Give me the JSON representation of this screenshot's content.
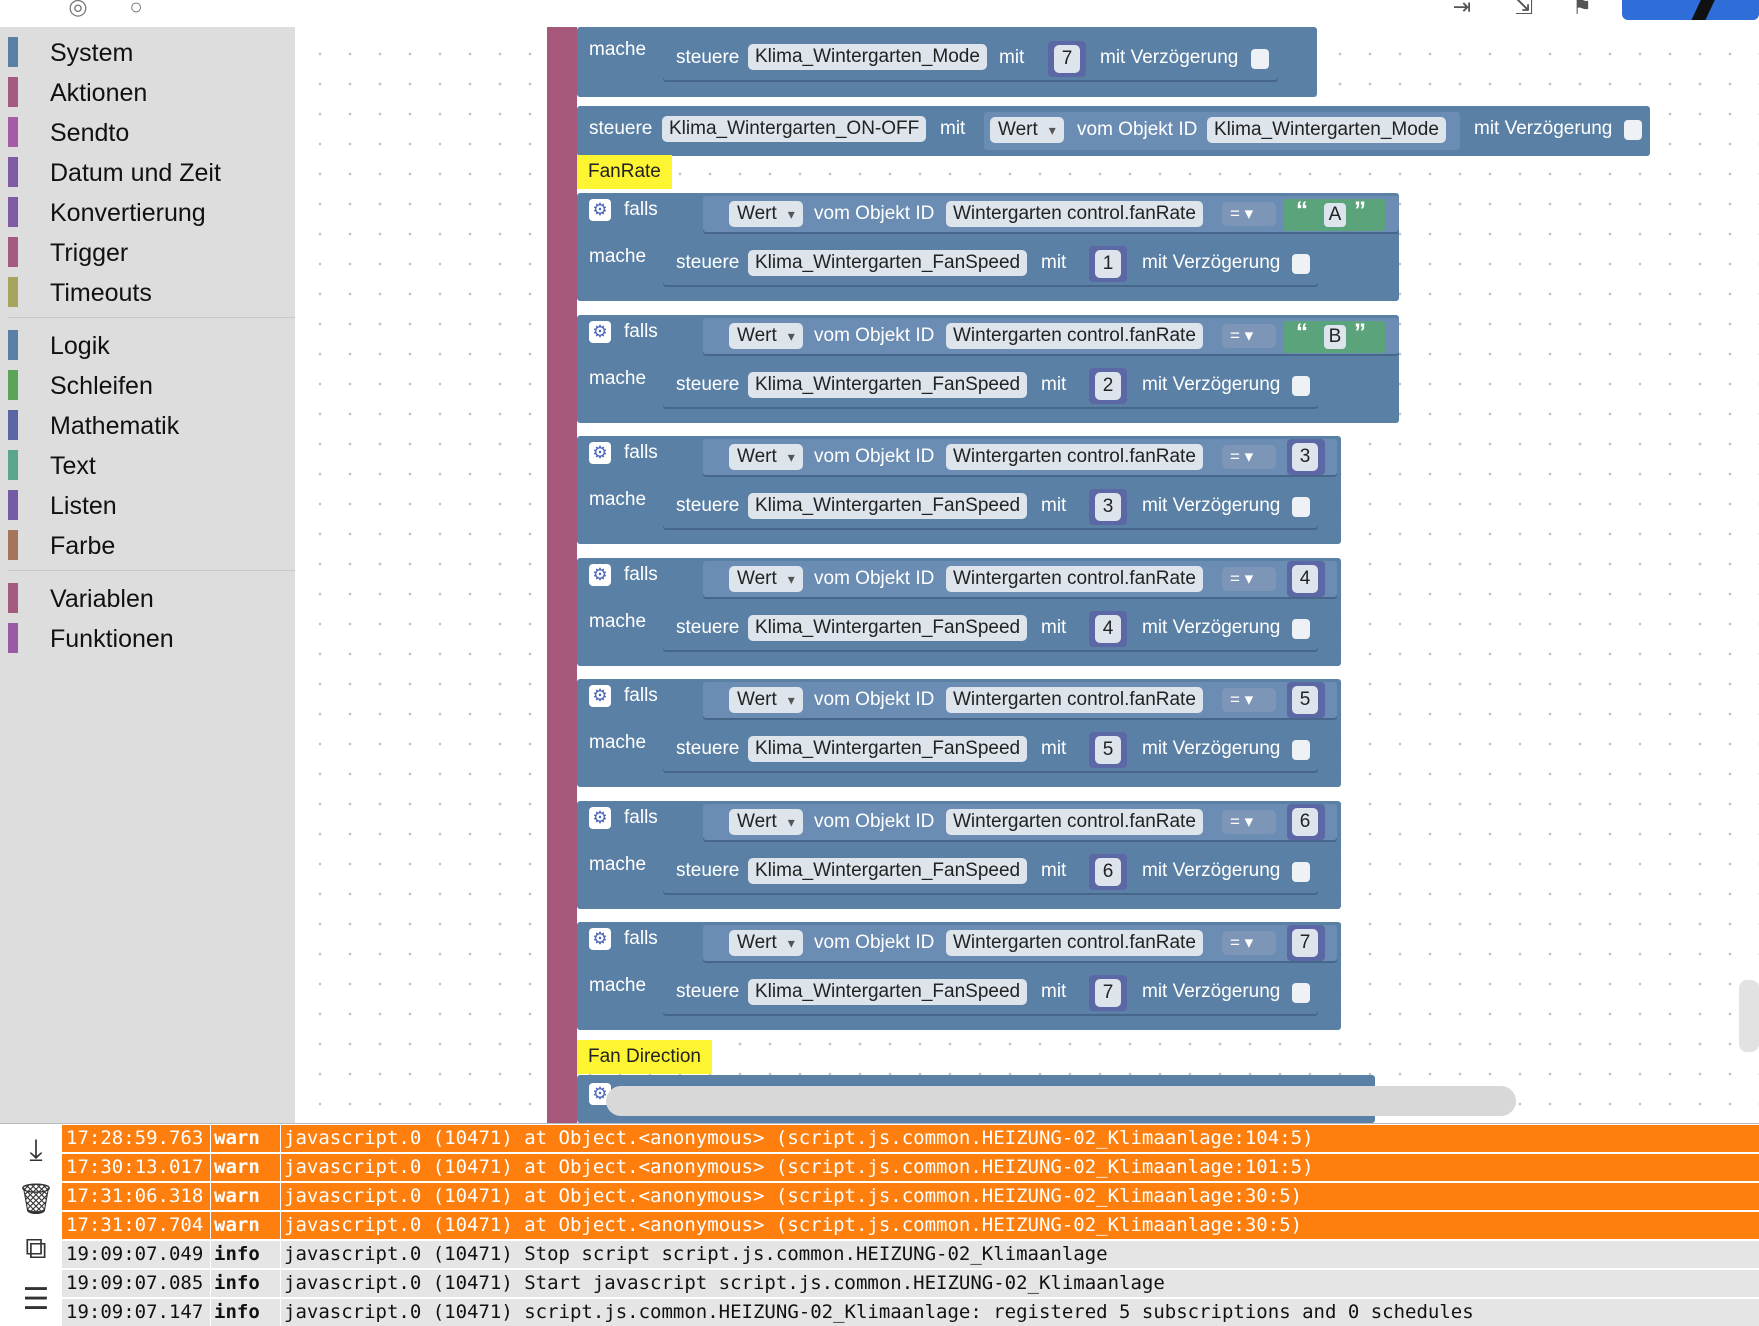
{
  "toolbox": {
    "categories": [
      {
        "label": "System",
        "color": "#5b80a5"
      },
      {
        "label": "Aktionen",
        "color": "#a55b80"
      },
      {
        "label": "Sendto",
        "color": "#a55ba5"
      },
      {
        "label": "Datum und Zeit",
        "color": "#805ba5"
      },
      {
        "label": "Konvertierung",
        "color": "#805ba5"
      },
      {
        "label": "Trigger",
        "color": "#a55b80"
      },
      {
        "label": "Timeouts",
        "color": "#a5a55b"
      },
      {
        "label": "Logik",
        "color": "#5b80a5"
      },
      {
        "label": "Schleifen",
        "color": "#5ba55b"
      },
      {
        "label": "Mathematik",
        "color": "#5b67a5"
      },
      {
        "label": "Text",
        "color": "#5ba58c"
      },
      {
        "label": "Listen",
        "color": "#745ba5"
      },
      {
        "label": "Farbe",
        "color": "#a5745b"
      },
      {
        "label": "Variablen",
        "color": "#a55b80"
      },
      {
        "label": "Funktionen",
        "color": "#995ba5"
      }
    ]
  },
  "blocks": {
    "top_mache": "mache",
    "top_steuere": "steuere",
    "top_target": "Klima_Wintergarten_Mode",
    "top_mit": "mit",
    "top_value": "7",
    "top_delay": "mit Verzögerung",
    "line2_steuere": "steuere",
    "line2_target": "Klima_Wintergarten_ON-OFF",
    "line2_mit": "mit",
    "line2_wert": "Wert",
    "line2_vom": "vom Objekt ID",
    "line2_obj": "Klima_Wintergarten_Mode",
    "line2_delay": "mit Verzögerung",
    "comment_fanrate": "FanRate",
    "comment_fandirection": "Fan Direction",
    "if_label": "falls",
    "do_label": "mache",
    "wert_label": "Wert",
    "vom_label": "vom Objekt ID",
    "object_id": "Wintergarten control.fanRate",
    "eq_label": "=",
    "steuere_label": "steuere",
    "fan_target": "Klima_Wintergarten_FanSpeed",
    "mit_label": "mit",
    "delay_label": "mit Verzögerung",
    "conditions": [
      {
        "compare": "A",
        "is_string": true,
        "set": "1"
      },
      {
        "compare": "B",
        "is_string": true,
        "set": "2"
      },
      {
        "compare": "3",
        "is_string": false,
        "set": "3"
      },
      {
        "compare": "4",
        "is_string": false,
        "set": "4"
      },
      {
        "compare": "5",
        "is_string": false,
        "set": "5"
      },
      {
        "compare": "6",
        "is_string": false,
        "set": "6"
      },
      {
        "compare": "7",
        "is_string": false,
        "set": "7"
      }
    ]
  },
  "log": {
    "rows": [
      {
        "time": "17:28:59.763",
        "severity": "warn",
        "message": "javascript.0 (10471) at Object.<anonymous> (script.js.common.HEIZUNG-02_Klimaanlage:104:5)"
      },
      {
        "time": "17:30:13.017",
        "severity": "warn",
        "message": "javascript.0 (10471) at Object.<anonymous> (script.js.common.HEIZUNG-02_Klimaanlage:101:5)"
      },
      {
        "time": "17:31:06.318",
        "severity": "warn",
        "message": "javascript.0 (10471) at Object.<anonymous> (script.js.common.HEIZUNG-02_Klimaanlage:30:5)"
      },
      {
        "time": "17:31:07.704",
        "severity": "warn",
        "message": "javascript.0 (10471) at Object.<anonymous> (script.js.common.HEIZUNG-02_Klimaanlage:30:5)"
      },
      {
        "time": "19:09:07.049",
        "severity": "info",
        "message": "javascript.0 (10471) Stop script script.js.common.HEIZUNG-02_Klimaanlage"
      },
      {
        "time": "19:09:07.085",
        "severity": "info",
        "message": "javascript.0 (10471) Start javascript script.js.common.HEIZUNG-02_Klimaanlage"
      },
      {
        "time": "19:09:07.147",
        "severity": "info",
        "message": "javascript.0 (10471) script.js.common.HEIZUNG-02_Klimaanlage: registered 5 subscriptions and 0 schedules"
      }
    ]
  },
  "colors": {
    "logic_block": "#5b80a5",
    "event_spine": "#a5587a",
    "math_block": "#5b68a5",
    "text_block": "#5ba37a",
    "comment": "#fef532",
    "warn_row": "#ff7f0e",
    "info_row": "#e5e5e5"
  }
}
